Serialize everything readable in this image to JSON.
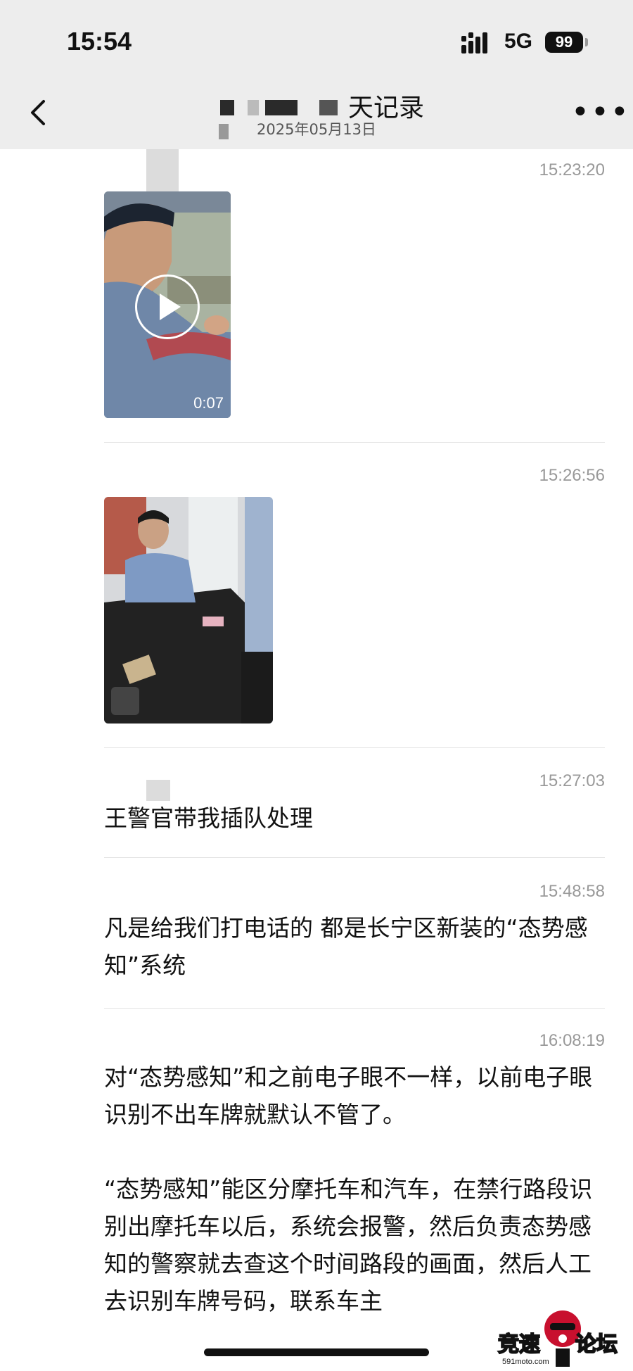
{
  "status_bar": {
    "time": "15:54",
    "network": "5G",
    "battery": "99"
  },
  "header": {
    "title": "天记录",
    "date": "2025年05月13日"
  },
  "messages": [
    {
      "timestamp": "15:23:20",
      "type": "video",
      "duration": "0:07"
    },
    {
      "timestamp": "15:26:56",
      "type": "image"
    },
    {
      "timestamp": "15:27:03",
      "type": "text",
      "text": "王警官带我插队处理"
    },
    {
      "timestamp": "15:48:58",
      "type": "text",
      "text": "凡是给我们打电话的 都是长宁区新装的“态势感知”系统"
    },
    {
      "timestamp": "16:08:19",
      "type": "text",
      "text": "对“态势感知”和之前电子眼不一样，以前电子眼识别不出车牌就默认不管了。\n\n“态势感知”能区分摩托车和汽车，在禁行路段识别出摩托车以后，系统会报警，然后负责态势感知的警察就去查这个时间路段的画面，然后人工去识别车牌号码，联系车主"
    }
  ],
  "watermark": {
    "text": "竞速论坛",
    "site": "591moto.com"
  },
  "colors": {
    "header_bg": "#ededed",
    "timestamp": "#999999",
    "divider": "#e3e3e3"
  },
  "icons": [
    "back-arrow-icon",
    "more-icon",
    "play-icon",
    "signal-icon"
  ]
}
